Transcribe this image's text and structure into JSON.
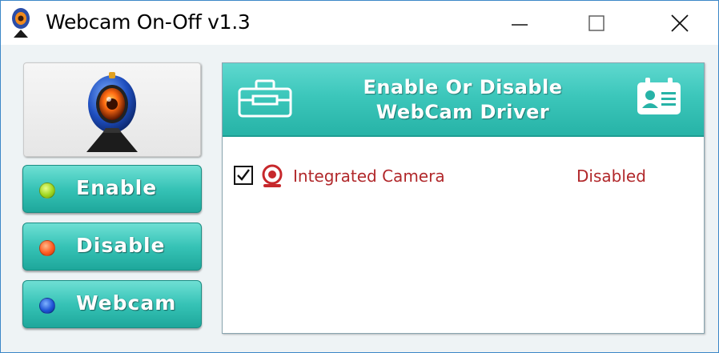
{
  "window": {
    "title": "Webcam On-Off v1.3",
    "controls": [
      "minimize",
      "maximize",
      "close"
    ]
  },
  "sidebar": {
    "logo_icon": "webcam-logo-icon",
    "buttons": [
      {
        "label": "Enable",
        "indicator_color": "#9fd620"
      },
      {
        "label": "Disable",
        "indicator_color": "#ff5c22"
      },
      {
        "label": "Webcam",
        "indicator_color": "#1f55d6"
      }
    ]
  },
  "panel": {
    "header_line1": "Enable Or Disable",
    "header_line2": "WebCam Driver",
    "header_left_icon": "toolbox-icon",
    "header_right_icon": "id-card-icon",
    "header_color": "#3cc7bb"
  },
  "devices": [
    {
      "name": "Integrated Camera",
      "status": "Disabled",
      "checked": true,
      "icon": "camera-device-icon"
    }
  ],
  "colors": {
    "accent": "#36c3b6",
    "device_text": "#b1282b",
    "window_border": "#3c87c8"
  }
}
